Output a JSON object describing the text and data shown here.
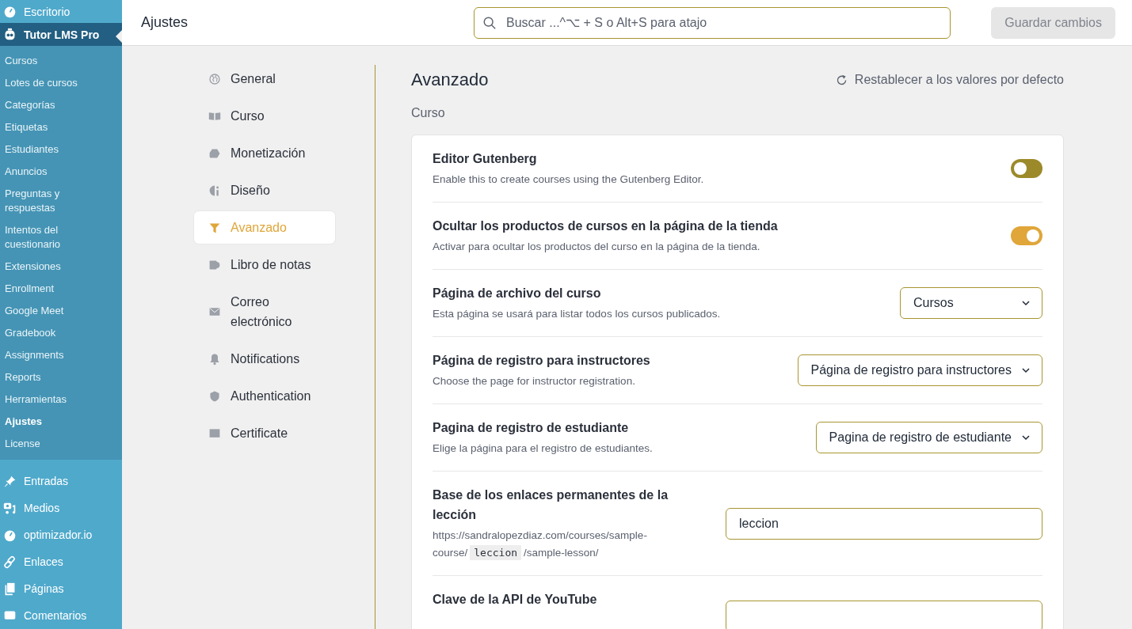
{
  "admin_menu": {
    "top": [
      {
        "label": "Escritorio",
        "selected": false
      }
    ],
    "current": {
      "label": "Tutor LMS Pro",
      "selected": true
    },
    "submenu": [
      {
        "label": "Cursos",
        "selected": false
      },
      {
        "label": "Lotes de cursos",
        "selected": false
      },
      {
        "label": "Categorías",
        "selected": false
      },
      {
        "label": "Etiquetas",
        "selected": false
      },
      {
        "label": "Estudiantes",
        "selected": false
      },
      {
        "label": "Anuncios",
        "selected": false
      },
      {
        "label": "Preguntas y respuestas",
        "selected": false
      },
      {
        "label": "Intentos del cuestionario",
        "selected": false
      },
      {
        "label": "Extensiones",
        "selected": false
      },
      {
        "label": "Enrollment",
        "selected": false
      },
      {
        "label": "Google Meet",
        "selected": false
      },
      {
        "label": "Gradebook",
        "selected": false
      },
      {
        "label": "Assignments",
        "selected": false
      },
      {
        "label": "Reports",
        "selected": false
      },
      {
        "label": "Herramientas",
        "selected": false
      },
      {
        "label": "Ajustes",
        "selected": true
      },
      {
        "label": "License",
        "selected": false
      }
    ],
    "bottom": [
      {
        "label": "Entradas",
        "selected": false
      },
      {
        "label": "Medios",
        "selected": false
      },
      {
        "label": "optimizador.io",
        "selected": false
      },
      {
        "label": "Enlaces",
        "selected": false
      },
      {
        "label": "Páginas",
        "selected": false
      },
      {
        "label": "Comentarios",
        "selected": false
      }
    ]
  },
  "header": {
    "title": "Ajustes",
    "search": {
      "placeholder": "Buscar ...^⌥ + S o Alt+S para atajo"
    },
    "save_button": {
      "label": "Guardar cambios",
      "disabled": true
    }
  },
  "settings_nav": [
    {
      "label": "General",
      "selected": false
    },
    {
      "label": "Curso",
      "selected": false
    },
    {
      "label": "Monetización",
      "selected": false
    },
    {
      "label": "Diseño",
      "selected": false
    },
    {
      "label": "Avanzado",
      "selected": true
    },
    {
      "label": "Libro de notas",
      "selected": false
    },
    {
      "label": "Correo electrónico",
      "selected": false
    },
    {
      "label": "Notifications",
      "selected": false
    },
    {
      "label": "Authentication",
      "selected": false
    },
    {
      "label": "Certificate",
      "selected": false
    }
  ],
  "section": {
    "title": "Avanzado",
    "reset_link": "Restablecer a los valores por defecto",
    "group": "Curso",
    "rows": [
      {
        "kind": "toggle",
        "title": "Editor Gutenberg",
        "description": "Enable this to create courses using the Gutenberg Editor.",
        "on": false
      },
      {
        "kind": "toggle",
        "title": "Ocultar los productos de cursos en la página de la tienda",
        "description": "Activar para ocultar los productos del curso en la página de la tienda.",
        "on": true
      },
      {
        "kind": "select",
        "title": "Página de archivo del curso",
        "description": "Esta página se usará para listar todos los cursos publicados.",
        "value": "Cursos"
      },
      {
        "kind": "select",
        "title": "Página de registro para instructores",
        "description": "Choose the page for instructor registration.",
        "value": "Página de registro para instructores"
      },
      {
        "kind": "select",
        "title": "Pagina de registro de estudiante",
        "description": "Elige la página para el registro de estudiantes.",
        "value": "Pagina de registro de estudiante"
      },
      {
        "kind": "text",
        "title": "Base de los enlaces permanentes de la lección",
        "description_parts": [
          {
            "kind": "text",
            "text": "https://sandralopezdiaz.com/courses/sample-course/"
          },
          {
            "kind": "code",
            "text": "leccion"
          },
          {
            "kind": "text",
            "text": "/sample-lesson/"
          }
        ],
        "value": "leccion"
      },
      {
        "kind": "text",
        "title": "Clave de la API de YouTube"
      }
    ]
  }
}
